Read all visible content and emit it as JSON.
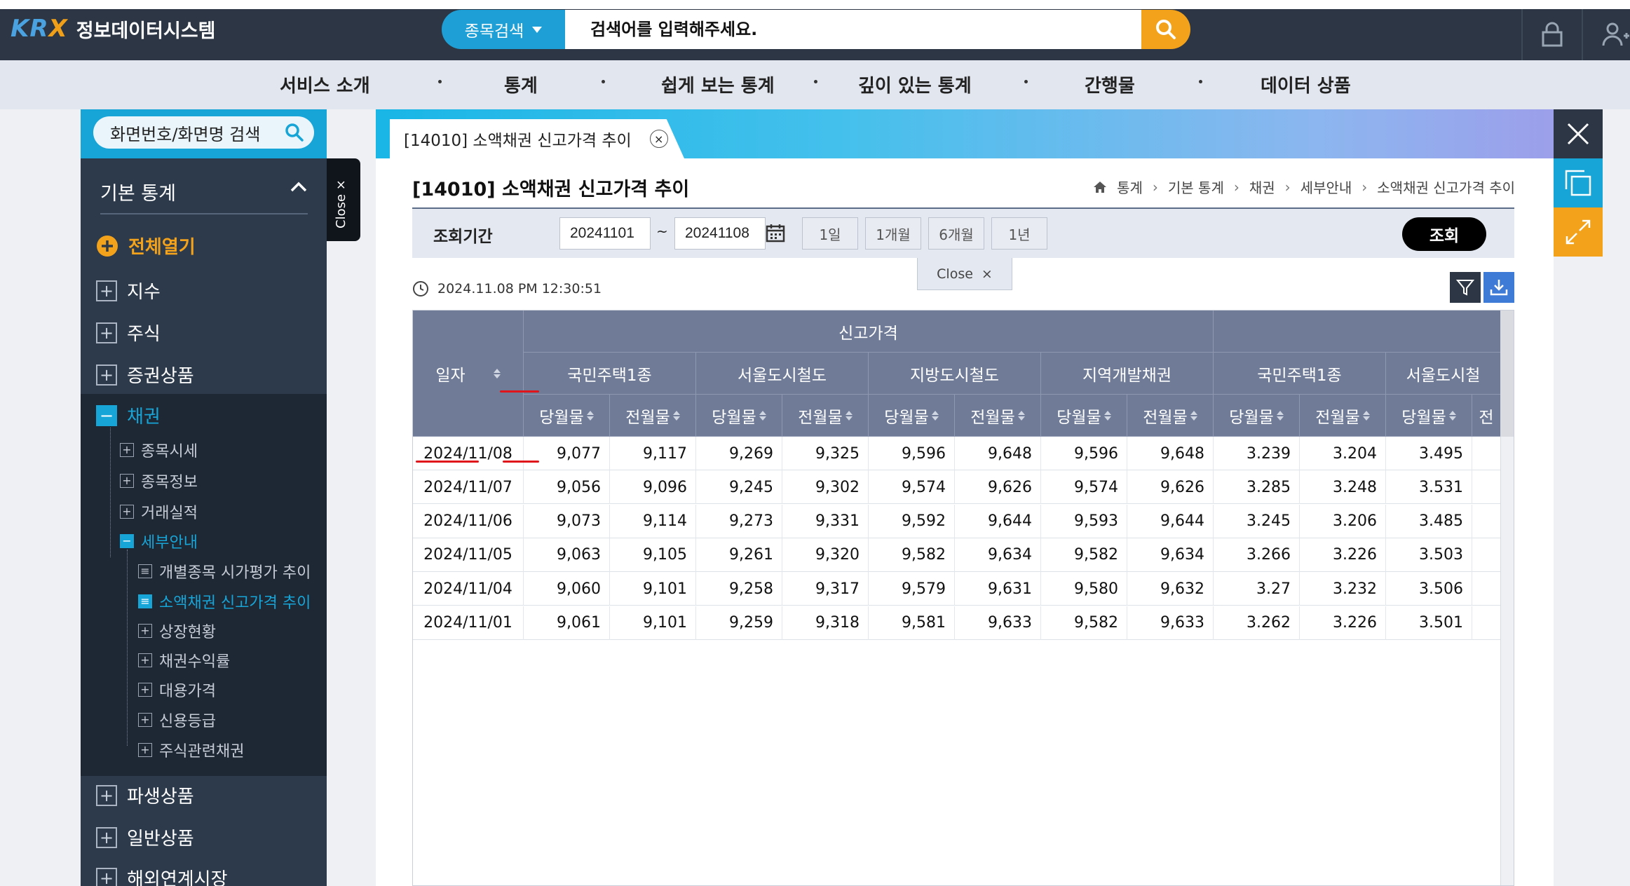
{
  "header": {
    "logo_text": "KRX",
    "logo_subtitle": "정보데이터시스템",
    "search_category": "종목검색",
    "search_placeholder": "검색어를 입력해주세요."
  },
  "nav": {
    "items": [
      "서비스 소개",
      "통계",
      "쉽게 보는 통계",
      "깊이 있는 통계",
      "간행물",
      "데이터 상품"
    ]
  },
  "sidebar": {
    "search_label": "화면번호/화면명 검색",
    "section_title": "기본 통계",
    "open_all": "전체열기",
    "close_label": "Close ×",
    "items": [
      "지수",
      "주식",
      "증권상품",
      "채권",
      "파생상품",
      "일반상품",
      "해외연계시장"
    ],
    "bond_children": [
      "종목시세",
      "종목정보",
      "거래실적",
      "세부안내"
    ],
    "detail_children": [
      "개별종목 시가평가 추이",
      "소액채권 신고가격 추이",
      "상장현황",
      "채권수익률",
      "대용가격",
      "신용등급",
      "주식관련채권"
    ]
  },
  "tab": {
    "label": "[14010] 소액채권 신고가격 추이"
  },
  "page": {
    "title": "[14010] 소액채권 신고가격 추이",
    "breadcrumb": [
      "통계",
      "기본 통계",
      "채권",
      "세부안내",
      "소액채권 신고가격 추이"
    ],
    "query_label": "조회기간",
    "start_date": "20241101",
    "tilde": "~",
    "end_date": "20241108",
    "periods": [
      "1일",
      "1개월",
      "6개월",
      "1년"
    ],
    "search_button": "조회",
    "close_popup": "Close",
    "timestamp": "2024.11.08 PM 12:30:51"
  },
  "table": {
    "date_header": "일자",
    "group1": "신고가격",
    "subgroups": [
      "국민주택1종",
      "서울도시철도",
      "지방도시철도",
      "지역개발채권",
      "국민주택1종",
      "서울도시철"
    ],
    "col_labels": [
      "당월물",
      "전월물",
      "당월물",
      "전월물",
      "당월물",
      "전월물",
      "당월물",
      "전월물",
      "당월물",
      "전월물",
      "당월물",
      "전"
    ],
    "rows": [
      {
        "date": "2024/11/08",
        "values": [
          "9,077",
          "9,117",
          "9,269",
          "9,325",
          "9,596",
          "9,648",
          "9,596",
          "9,648",
          "3.239",
          "3.204",
          "3.495"
        ]
      },
      {
        "date": "2024/11/07",
        "values": [
          "9,056",
          "9,096",
          "9,245",
          "9,302",
          "9,574",
          "9,626",
          "9,574",
          "9,626",
          "3.285",
          "3.248",
          "3.531"
        ]
      },
      {
        "date": "2024/11/06",
        "values": [
          "9,073",
          "9,114",
          "9,273",
          "9,331",
          "9,592",
          "9,644",
          "9,593",
          "9,644",
          "3.245",
          "3.206",
          "3.485"
        ]
      },
      {
        "date": "2024/11/05",
        "values": [
          "9,063",
          "9,105",
          "9,261",
          "9,320",
          "9,582",
          "9,634",
          "9,582",
          "9,634",
          "3.266",
          "3.226",
          "3.503"
        ]
      },
      {
        "date": "2024/11/04",
        "values": [
          "9,060",
          "9,101",
          "9,258",
          "9,317",
          "9,579",
          "9,631",
          "9,580",
          "9,632",
          "3.27",
          "3.232",
          "3.506"
        ]
      },
      {
        "date": "2024/11/01",
        "values": [
          "9,061",
          "9,101",
          "9,259",
          "9,318",
          "9,581",
          "9,633",
          "9,582",
          "9,633",
          "3.262",
          "3.226",
          "3.501"
        ]
      }
    ]
  },
  "colors": {
    "header_bg": "#2c3644",
    "accent_blue": "#17a5d7",
    "accent_orange": "#f3a21b",
    "table_header": "#6f7b97",
    "sidebar_active": "#17a5d7",
    "annotation_red": "#e0141b"
  }
}
